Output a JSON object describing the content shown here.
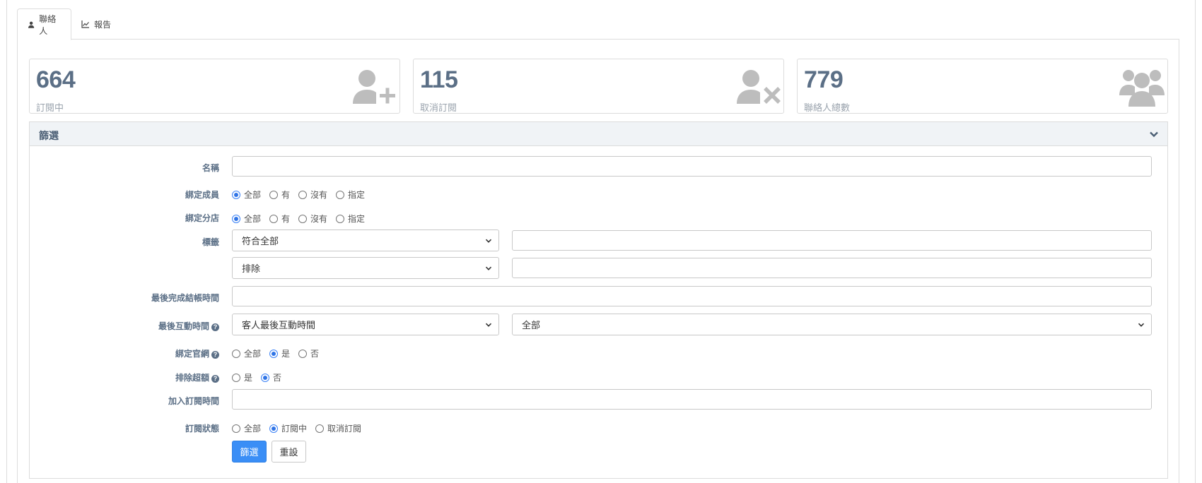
{
  "tabs": [
    {
      "label": "聯絡人",
      "icon": "user-icon"
    },
    {
      "label": "報告",
      "icon": "line-chart-icon"
    }
  ],
  "stats": [
    {
      "value": "664",
      "label": "訂閱中",
      "icon": "user-plus-icon"
    },
    {
      "value": "115",
      "label": "取消訂閱",
      "icon": "user-times-icon"
    },
    {
      "value": "779",
      "label": "聯絡人總數",
      "icon": "users-icon"
    }
  ],
  "filter": {
    "title": "篩選",
    "name_label": "名稱",
    "bind_member": {
      "label": "綁定成員",
      "options": [
        "全部",
        "有",
        "沒有",
        "指定"
      ],
      "selected": "全部"
    },
    "bind_store": {
      "label": "綁定分店",
      "options": [
        "全部",
        "有",
        "沒有",
        "指定"
      ],
      "selected": "全部"
    },
    "tags": {
      "label": "標籤",
      "match_select": "符合全部",
      "exclude_select": "排除"
    },
    "last_checkout_label": "最後完成結帳時間",
    "last_interaction": {
      "label": "最後互動時間",
      "type_select": "客人最後互動時間",
      "range_select": "全部"
    },
    "bind_website": {
      "label": "綁定官網",
      "options": [
        "全部",
        "是",
        "否"
      ],
      "selected": "是"
    },
    "exclude_over": {
      "label": "排除超額",
      "options": [
        "是",
        "否"
      ],
      "selected": "否"
    },
    "join_time_label": "加入訂閱時間",
    "sub_status": {
      "label": "訂閱狀態",
      "options": [
        "全部",
        "訂閱中",
        "取消訂閱"
      ],
      "selected": "訂閱中"
    },
    "submit_label": "篩選",
    "reset_label": "重設"
  },
  "colors": {
    "accent": "#3a8ef6",
    "stat_number": "#5b6f86",
    "header_bg": "#f0f3f6"
  }
}
